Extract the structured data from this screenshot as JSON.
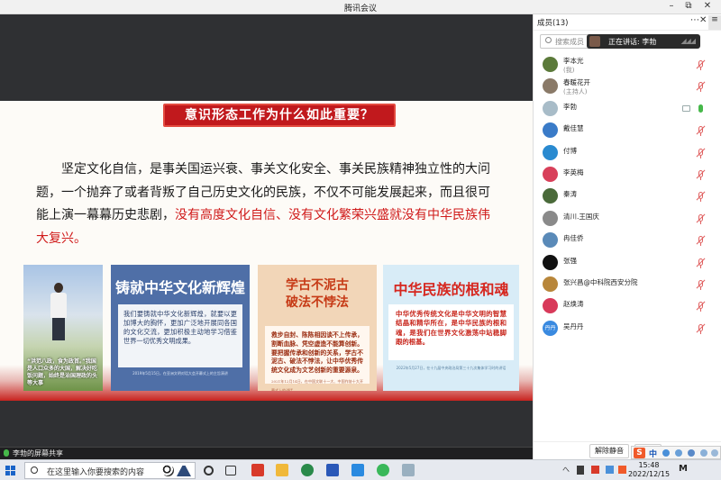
{
  "window": {
    "title": "腾讯会议"
  },
  "slide": {
    "heading": "意识形态工作为什么如此重要？",
    "paragraph_plain": "坚定文化自信，是事关国运兴衰、事关文化安全、事关民族精神独立性的大问题，一个抛弃了或者背叛了自己历史文化的民族，不仅不可能发展起来，而且很可能上演一幕幕历史悲剧，",
    "paragraph_highlight": "没有高度文化自信、没有文化繁荣兴盛就没有中华民族伟大复兴。",
    "card1_caption": "“洪范八政，食为政首。”我国是人口众多的大国，解决好吃饭问题，始终是治国理政的头等大事",
    "card2_title": "铸就中华文化新辉煌",
    "card2_text": "我们要铸就中华文化新辉煌，就要以更加博大的胸怀，更加广泛地开展同各国的文化交流，更加积极主动地学习借鉴世界一切优秀文明成果。",
    "card2_footer": "2019年5月15日，在亚洲文明对话大会开幕式上的主旨演讲",
    "card3_title_1": "学古不泥古",
    "card3_title_2": "破法不悖法",
    "card3_text": "救步自封、陈陈相因谈不上传承，割断血脉、凭空虚造不能算创新。要把握传承和创新的关系，学古不泥古、破法不悖法，让中华优秀传统文化成为文艺创新的重要源泉。",
    "card3_footer": "2021年12月14日，在中国文联十一大、中国作协十大开幕式上的讲话",
    "card4_title": "中华民族的根和魂",
    "card4_text": "中华优秀传统文化是中华文明的智慧结晶和精华所在，是中华民族的根和魂，是我们在世界文化激荡中站稳脚跟的根基。",
    "card4_footer": "2022年5月27日，在十九届中央政治局第三十九次集体学习时的讲话"
  },
  "share_bar": {
    "label": "李勃的屏幕共享"
  },
  "panel": {
    "header": "成员(13)",
    "more_icon": "⋯",
    "search_placeholder": "搜索成员",
    "speaking_label": "正在讲话: 李勃",
    "members": [
      {
        "name": "李本光",
        "role": "(我)",
        "color": "#5b7a3a"
      },
      {
        "name": "春暖花开",
        "role": "(主持人)",
        "color": "#8a7a68"
      },
      {
        "name": "李勃",
        "role": "",
        "color": "#a8bcc8"
      },
      {
        "name": "戴佳慧",
        "role": "",
        "color": "#3a7bc8"
      },
      {
        "name": "付博",
        "role": "",
        "color": "#2a8ad0"
      },
      {
        "name": "李英梅",
        "role": "",
        "color": "#d8405a"
      },
      {
        "name": "秦涛",
        "role": "",
        "color": "#4a6a3a"
      },
      {
        "name": "清川.王国庆",
        "role": "",
        "color": "#8a8a8a"
      },
      {
        "name": "冉佳侨",
        "role": "",
        "color": "#5a8ab8"
      },
      {
        "name": "张强",
        "role": "",
        "color": "#111111"
      },
      {
        "name": "张兴昌@中科院西安分院",
        "role": "",
        "color": "#b8863a"
      },
      {
        "name": "赵焕涛",
        "role": "",
        "color": "#d83a5a"
      },
      {
        "name": "吴丹丹",
        "role": "",
        "color": "#3a8ae0",
        "initials": "丹丹"
      }
    ],
    "unmute_all_label": "解除静音",
    "more_label": "..."
  },
  "ime": {
    "brand": "S",
    "lang": "中"
  },
  "taskbar": {
    "search_placeholder": "在这里输入你要搜索的内容",
    "time": "15:48",
    "date": "2022/12/15",
    "tray_text": "へ"
  }
}
